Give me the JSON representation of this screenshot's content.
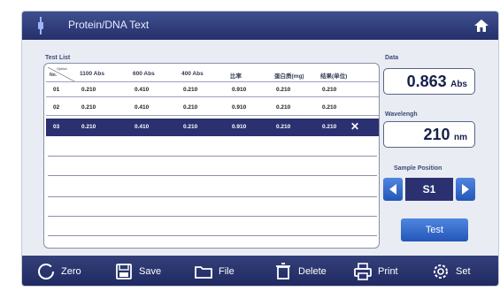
{
  "header": {
    "title": "Protein/DNA Text",
    "home_icon": "home-icon"
  },
  "test_list": {
    "label": "Test List",
    "header_first": {
      "option": "Option",
      "no": "No."
    },
    "columns": [
      "1100 Abs",
      "600 Abs",
      "400 Abs",
      "比率",
      "蛋白质(mg)",
      "结果(单位)"
    ],
    "rows": [
      {
        "no": "01",
        "values": [
          "0.210",
          "0.410",
          "0.210",
          "0.910",
          "0.210",
          "0.210"
        ]
      },
      {
        "no": "02",
        "values": [
          "0.210",
          "0.410",
          "0.210",
          "0.910",
          "0.210",
          "0.210"
        ]
      },
      {
        "no": "03",
        "values": [
          "0.210",
          "0.410",
          "0.210",
          "0.910",
          "0.210",
          "0.210"
        ],
        "close": "✕"
      }
    ]
  },
  "data": {
    "label": "Data",
    "value": "0.863",
    "unit": "Abs"
  },
  "wavelength": {
    "label": "Wavelengh",
    "value": "210",
    "unit": "nm"
  },
  "sample_position": {
    "label": "Sample Position",
    "value": "S1"
  },
  "test_button": "Test",
  "toolbar": {
    "zero": "Zero",
    "save": "Save",
    "file": "File",
    "delete": "Delete",
    "print": "Print",
    "set": "Set"
  },
  "colors": {
    "title_bar": "#2f3a78",
    "selected_row": "#2a3070",
    "button_blue": "#3a6fd0"
  }
}
